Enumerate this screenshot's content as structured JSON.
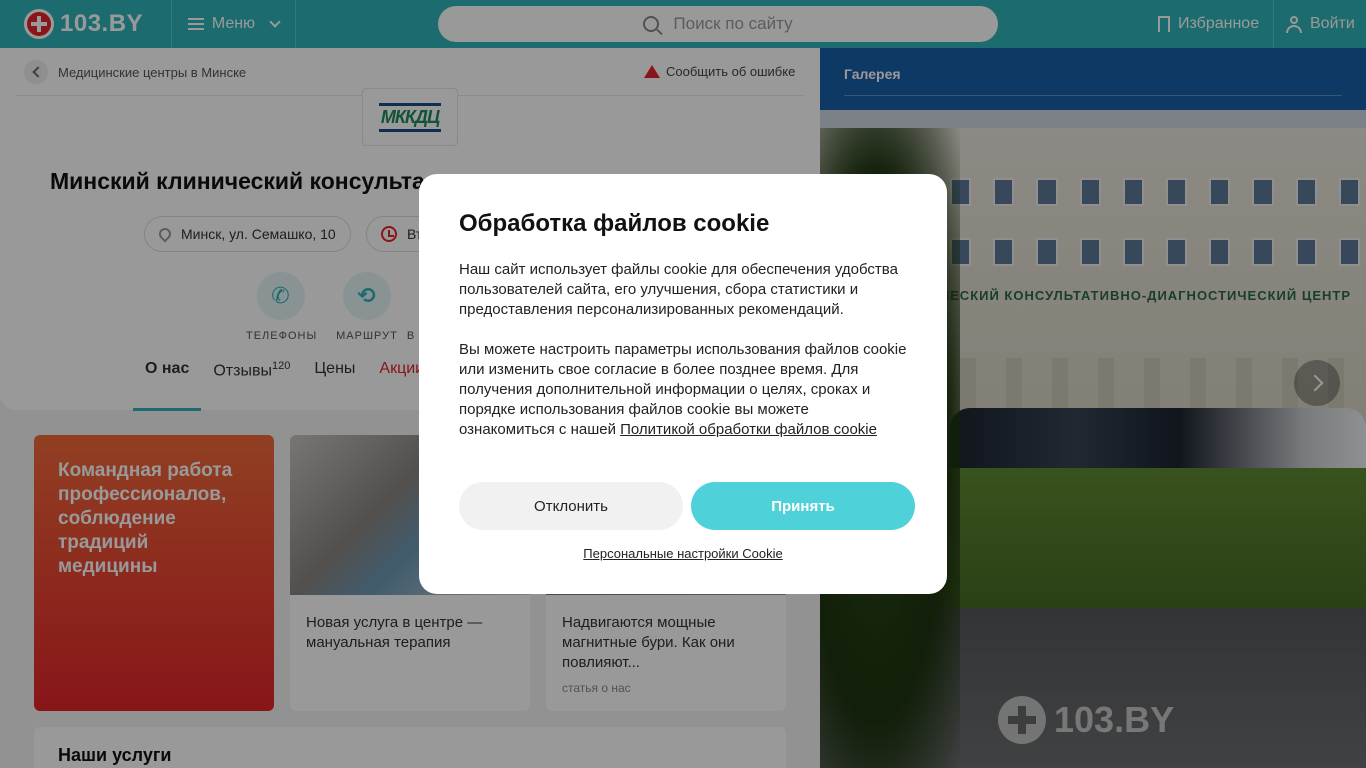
{
  "header": {
    "logo_text": "103.BY",
    "menu_label": "Меню",
    "search_placeholder": "Поиск по сайту",
    "favorites_label": "Избранное",
    "login_label": "Войти",
    "brand_color": "#2fb5b9"
  },
  "breadcrumb": {
    "label": "Медицинские центры в Минске"
  },
  "report_error_label": "Сообщить об ошибке",
  "org": {
    "logo_text": "МККДЦ",
    "title": "Минский клинический консульта",
    "address": "Минск, ул. Семашко, 10",
    "hours_partial": "Вт"
  },
  "actions": [
    {
      "label": "ТЕЛЕФОНЫ",
      "icon": "phone-icon"
    },
    {
      "label": "МАРШРУТ",
      "icon": "route-icon"
    },
    {
      "label": "В",
      "icon": "partial-icon"
    }
  ],
  "tabs": [
    {
      "label": "О нас"
    },
    {
      "label": "Отзывы",
      "count": "120"
    },
    {
      "label": "Цены"
    },
    {
      "label": "Акции"
    }
  ],
  "promo": {
    "text": "Командная работа профессионалов, соблюдение традиций медицины"
  },
  "news": [
    {
      "text": "Новая услуга в центре — мануальная терапия",
      "tag": ""
    },
    {
      "text": "Надвигаются мощные магнитные бури. Как они повлияют...",
      "tag": "статья о нас"
    }
  ],
  "services_title": "Наши услуги",
  "gallery": {
    "title": "Галерея",
    "building_sign": "ЧЕСКИЙ КОНСУЛЬТАТИВНО-ДИАГНОСТИЧЕСКИЙ ЦЕНТР",
    "watermark": "103.BY"
  },
  "cookie_modal": {
    "title": "Обработка файлов cookie",
    "paragraph1": "Наш сайт использует файлы cookie для обеспечения удобства пользователей сайта, его улучшения, сбора статистики и предоставления персонализированных рекомендаций.",
    "paragraph2": "Вы можете настроить параметры использования файлов cookie или изменить свое согласие в более позднее время. Для получения дополнительной информации о целях, сроках и порядке использования файлов cookie вы можете ознакомиться с нашей",
    "policy_link": "Политикой обработки файлов cookie",
    "decline_label": "Отклонить",
    "accept_label": "Принять",
    "settings_link": "Персональные настройки Cookie",
    "accent_color": "#4fd1d9"
  }
}
